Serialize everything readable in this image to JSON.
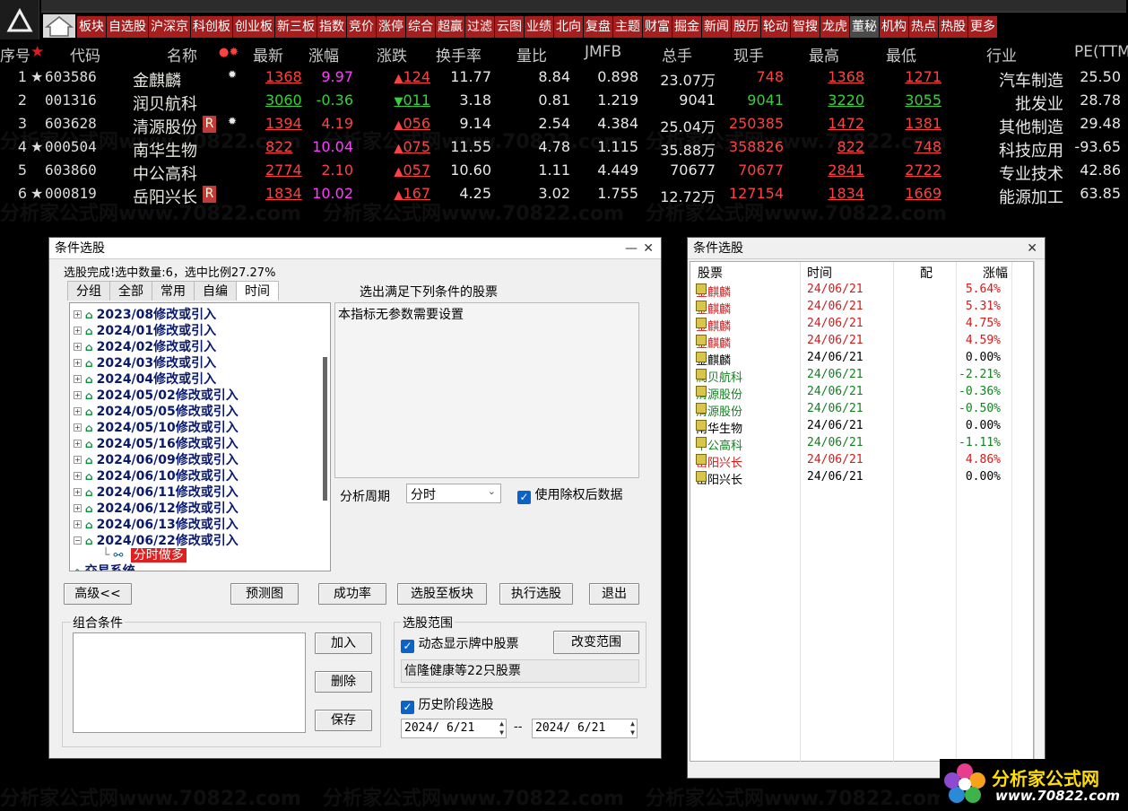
{
  "toolbar": {
    "items": [
      {
        "label": "板块",
        "style": "red"
      },
      {
        "label": "自选股",
        "style": "red"
      },
      {
        "label": "沪深京",
        "style": "red"
      },
      {
        "label": "科创板",
        "style": "red"
      },
      {
        "label": "创业板",
        "style": "red"
      },
      {
        "label": "新三板",
        "style": "red"
      },
      {
        "label": "指数",
        "style": "red"
      },
      {
        "label": "竞价",
        "style": "red"
      },
      {
        "label": "涨停",
        "style": "red"
      },
      {
        "label": "综合",
        "style": "red"
      },
      {
        "label": "超赢",
        "style": "red"
      },
      {
        "label": "过滤",
        "style": "red"
      },
      {
        "label": "云图",
        "style": "red"
      },
      {
        "label": "业绩",
        "style": "red"
      },
      {
        "label": "北向",
        "style": "red"
      },
      {
        "label": "复盘",
        "style": "red"
      },
      {
        "label": "主题",
        "style": "red"
      },
      {
        "label": "财富",
        "style": "red"
      },
      {
        "label": "掘金",
        "style": "red"
      },
      {
        "label": "新闻",
        "style": "red"
      },
      {
        "label": "股历",
        "style": "red"
      },
      {
        "label": "轮动",
        "style": "red"
      },
      {
        "label": "智搜",
        "style": "red"
      },
      {
        "label": "龙虎",
        "style": "red"
      },
      {
        "label": "董秘",
        "style": "gray"
      },
      {
        "label": "机构",
        "style": "red"
      },
      {
        "label": "热点",
        "style": "red"
      },
      {
        "label": "热股",
        "style": "red"
      },
      {
        "label": "更多",
        "style": "red"
      }
    ]
  },
  "table": {
    "headers": {
      "idx": "序号",
      "star": "★",
      "code": "代码",
      "name": "名称",
      "dots": "●✹",
      "latest": "最新",
      "pct": "涨幅",
      "chg": "涨跌",
      "turnover": "换手率",
      "volratio": "量比",
      "jmfb": "JMFB",
      "total": "总手",
      "current": "现手",
      "high": "最高",
      "low": "最低",
      "industry": "行业",
      "pe": "PE(TTM"
    },
    "rows": [
      {
        "idx": "1",
        "star": "★",
        "code": "603586",
        "name": "金麒麟",
        "R": "",
        "flag": "✹",
        "latest": "1368",
        "pct": "9.97",
        "chg": "124",
        "dir": "up",
        "turnover": "11.77",
        "volratio": "8.84",
        "jmfb": "0.898",
        "total": "23.07万",
        "current": "748",
        "high": "1368",
        "low": "1271",
        "industry": "汽车制造",
        "pe": "25.50"
      },
      {
        "idx": "2",
        "star": "",
        "code": "001316",
        "name": "润贝航科",
        "R": "",
        "flag": "",
        "latest": "3060",
        "pct": "-0.36",
        "chg": "011",
        "dir": "down",
        "turnover": "3.18",
        "volratio": "0.81",
        "jmfb": "1.219",
        "total": "9041",
        "current": "9041",
        "high": "3220",
        "low": "3055",
        "industry": "批发业",
        "pe": "28.78"
      },
      {
        "idx": "3",
        "star": "",
        "code": "603628",
        "name": "清源股份",
        "R": "R",
        "flag": "✹",
        "latest": "1394",
        "pct": "4.19",
        "chg": "056",
        "dir": "up",
        "turnover": "9.14",
        "volratio": "2.54",
        "jmfb": "4.384",
        "total": "25.04万",
        "current": "250385",
        "high": "1472",
        "low": "1381",
        "industry": "其他制造",
        "pe": "29.48"
      },
      {
        "idx": "4",
        "star": "★",
        "code": "000504",
        "name": "南华生物",
        "R": "",
        "flag": "",
        "latest": "822",
        "pct": "10.04",
        "chg": "075",
        "dir": "up",
        "turnover": "11.55",
        "volratio": "4.78",
        "jmfb": "1.115",
        "total": "35.88万",
        "current": "358826",
        "high": "822",
        "low": "748",
        "industry": "科技应用",
        "pe": "-93.65"
      },
      {
        "idx": "5",
        "star": "",
        "code": "603860",
        "name": "中公高科",
        "R": "",
        "flag": "",
        "latest": "2774",
        "pct": "2.10",
        "chg": "057",
        "dir": "up",
        "turnover": "10.60",
        "volratio": "1.11",
        "jmfb": "4.449",
        "total": "70677",
        "current": "70677",
        "high": "2841",
        "low": "2722",
        "industry": "专业技术",
        "pe": "42.86"
      },
      {
        "idx": "6",
        "star": "★",
        "code": "000819",
        "name": "岳阳兴长",
        "R": "R",
        "flag": "",
        "latest": "1834",
        "pct": "10.02",
        "chg": "167",
        "dir": "up",
        "turnover": "4.25",
        "volratio": "3.02",
        "jmfb": "1.755",
        "total": "12.72万",
        "current": "127154",
        "high": "1834",
        "low": "1669",
        "industry": "能源加工",
        "pe": "63.85"
      }
    ]
  },
  "dialog_left": {
    "title": "条件选股",
    "status": "选股完成!选中数量:6，选中比例27.27%",
    "tabs": [
      "分组",
      "全部",
      "常用",
      "自编",
      "时间"
    ],
    "active_tab": "时间",
    "tree_items": [
      "2023/08修改或引入",
      "2024/01修改或引入",
      "2024/02修改或引入",
      "2024/03修改或引入",
      "2024/04修改或引入",
      "2024/05/02修改或引入",
      "2024/05/05修改或引入",
      "2024/05/10修改或引入",
      "2024/05/16修改或引入",
      "2024/06/09修改或引入",
      "2024/06/10修改或引入",
      "2024/06/11修改或引入",
      "2024/06/12修改或引入",
      "2024/06/13修改或引入",
      "2024/06/22修改或引入"
    ],
    "tree_child": "分时做多",
    "tree_partial": "交易系统",
    "right_title": "选出满足下列条件的股票",
    "param_text": "本指标无参数需要设置",
    "period_label": "分析周期",
    "period_value": "分时",
    "use_adjusted": "使用除权后数据",
    "buttons": {
      "advanced": "高级<<",
      "preview": "预测图",
      "success": "成功率",
      "to_block": "选股至板块",
      "execute": "执行选股",
      "exit": "退出"
    },
    "combo_title": "组合条件",
    "combo_add": "加入",
    "combo_delete": "删除",
    "combo_save": "保存",
    "range_title": "选股范围",
    "range_dynamic": "动态显示牌中股票",
    "range_change": "改变范围",
    "range_text": "信隆健康等22只股票",
    "history_label": "历史阶段选股",
    "date_from": "2024/ 6/21",
    "date_sep": "--",
    "date_to": "2024/ 6/21"
  },
  "dialog_right": {
    "title": "条件选股",
    "headers": {
      "stock": "股票",
      "time": "时间",
      "config": "配",
      "pct": "涨幅"
    },
    "rows": [
      {
        "name": "金麒麟",
        "time": "24/06/21",
        "pct": "5.64%",
        "color": "r"
      },
      {
        "name": "金麒麟",
        "time": "24/06/21",
        "pct": "5.31%",
        "color": "r"
      },
      {
        "name": "金麒麟",
        "time": "24/06/21",
        "pct": "4.75%",
        "color": "r"
      },
      {
        "name": "金麒麟",
        "time": "24/06/21",
        "pct": "4.59%",
        "color": "r"
      },
      {
        "name": "金麒麟",
        "time": "24/06/21",
        "pct": "0.00%",
        "color": "b"
      },
      {
        "name": "润贝航科",
        "time": "24/06/21",
        "pct": "-2.21%",
        "color": "g"
      },
      {
        "name": "清源股份",
        "time": "24/06/21",
        "pct": "-0.36%",
        "color": "g"
      },
      {
        "name": "清源股份",
        "time": "24/06/21",
        "pct": "-0.50%",
        "color": "g"
      },
      {
        "name": "南华生物",
        "time": "24/06/21",
        "pct": "0.00%",
        "color": "b"
      },
      {
        "name": "中公高科",
        "time": "24/06/21",
        "pct": "-1.11%",
        "color": "g"
      },
      {
        "name": "岳阳兴长",
        "time": "24/06/21",
        "pct": "4.86%",
        "color": "r"
      },
      {
        "name": "岳阳兴长",
        "time": "24/06/21",
        "pct": "0.00%",
        "color": "b"
      }
    ]
  },
  "watermark": {
    "text": "分析家公式网www.70822.com",
    "brand": "分析家公式网",
    "url": "www.70822.com"
  }
}
